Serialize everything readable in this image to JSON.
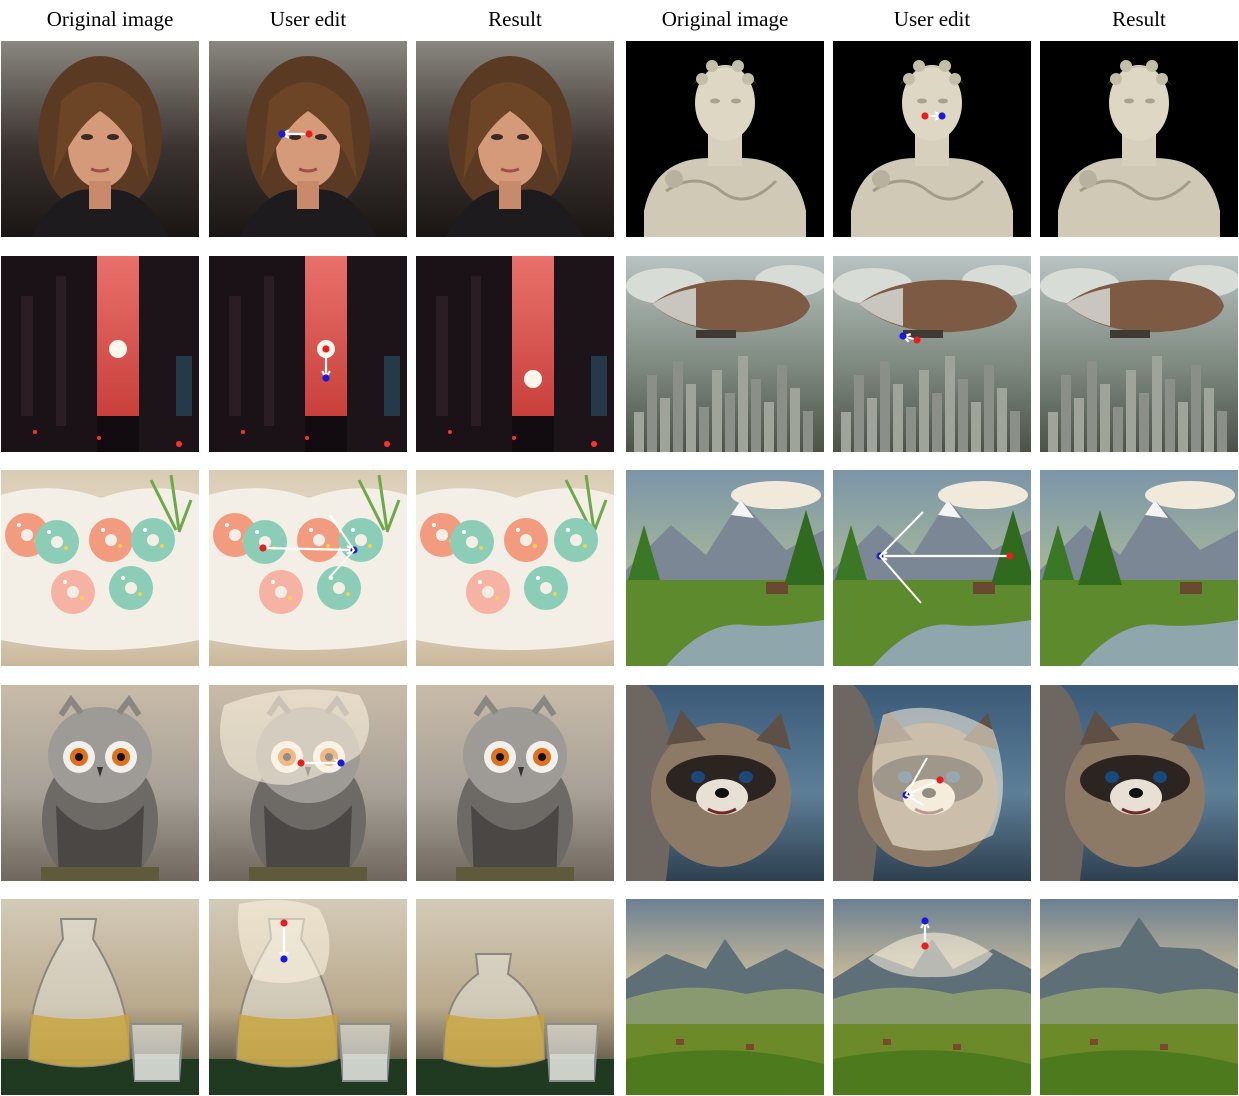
{
  "headers": [
    "Original image",
    "User edit",
    "Result",
    "Original image",
    "User edit",
    "Result"
  ],
  "rows": [
    {
      "left": "portrait-woman",
      "right": "marble-bust"
    },
    {
      "left": "city-sunset",
      "right": "airship-city"
    },
    {
      "left": "donuts",
      "right": "mountain-valley-river"
    },
    {
      "left": "owl",
      "right": "raccoon"
    },
    {
      "left": "carafe-glass",
      "right": "mountain-landscape"
    }
  ],
  "colors": {
    "handle_point": "#e81e1e",
    "target_point": "#1a1ad9",
    "arrow": "#ffffff",
    "mask": "rgba(255,245,225,0.55)"
  }
}
